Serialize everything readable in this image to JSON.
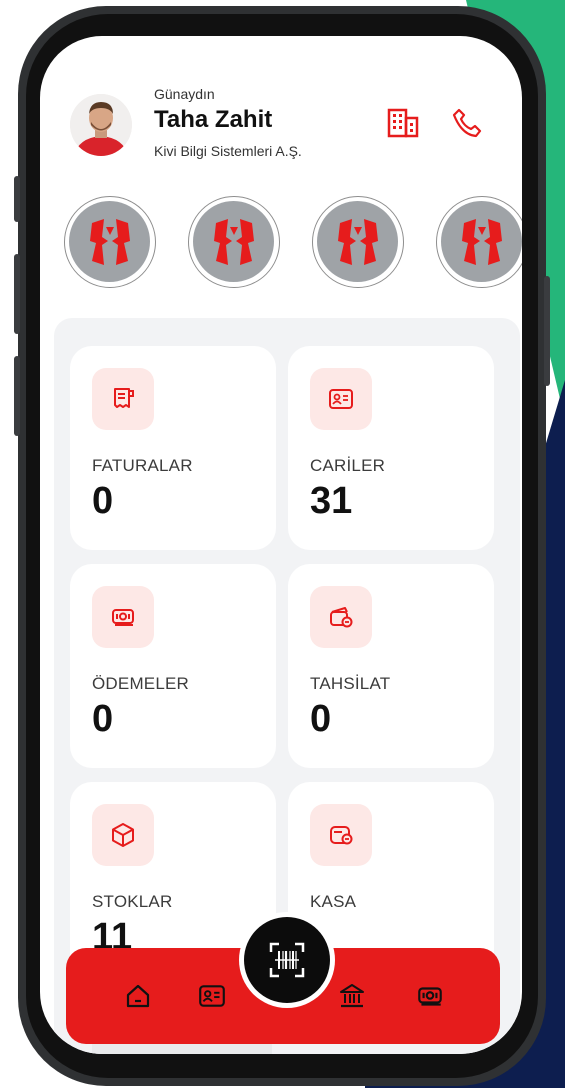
{
  "header": {
    "greeting": "Günaydın",
    "user_name": "Taha Zahit",
    "company": "Kivi Bilgi Sistemleri A.Ş."
  },
  "icons": {
    "company": "building-icon",
    "phone": "phone-icon",
    "scan": "barcode-scan-icon"
  },
  "stories": [
    {
      "name": "story-1"
    },
    {
      "name": "story-2"
    },
    {
      "name": "story-3"
    },
    {
      "name": "story-4"
    }
  ],
  "dashboard": {
    "cards": [
      {
        "label": "FATURALAR",
        "value": "0",
        "icon": "invoice-icon"
      },
      {
        "label": "CARİLER",
        "value": "31",
        "icon": "contact-card-icon"
      },
      {
        "label": "ÖDEMELER",
        "value": "0",
        "icon": "cash-icon"
      },
      {
        "label": "TAHSİLAT",
        "value": "0",
        "icon": "collection-icon"
      },
      {
        "label": "STOKLAR",
        "value": "11",
        "icon": "box-icon"
      },
      {
        "label": "KASA",
        "value": "",
        "icon": "wallet-icon"
      }
    ]
  },
  "nav": {
    "items": [
      "home-icon",
      "contact-card-icon",
      "bank-icon",
      "cash-icon"
    ]
  },
  "colors": {
    "accent": "#E61C1C",
    "icon_bg": "#FDE8E6",
    "green": "#25B67A",
    "navy": "#0D1E4F"
  }
}
